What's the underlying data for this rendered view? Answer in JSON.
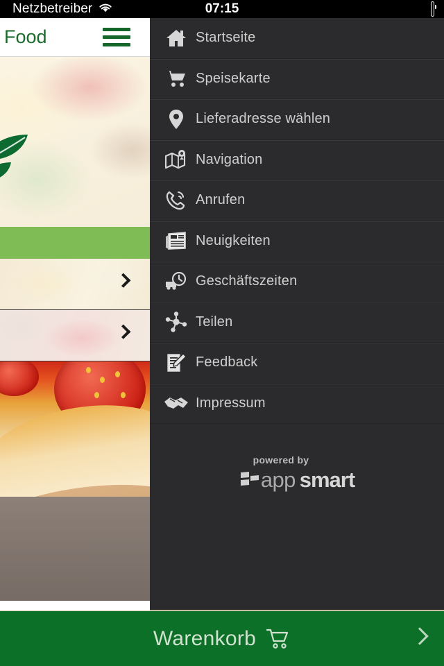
{
  "status_bar": {
    "carrier": "Netzbetreiber",
    "wifi_icon": "wifi-icon",
    "time": "07:15",
    "battery_icon": "battery-full-icon"
  },
  "app": {
    "title": "Food",
    "menu_button_icon": "hamburger-menu-icon",
    "hero_logo_icon": "leaf-logo-icon",
    "promo_band_color": "#7fbc56",
    "rows": [
      {
        "chevron_icon": "chevron-right-icon"
      },
      {
        "chevron_icon": "chevron-right-icon"
      }
    ]
  },
  "menu": {
    "background_color": "#2b2b2d",
    "items": [
      {
        "label": "Startseite",
        "icon": "home-icon"
      },
      {
        "label": "Speisekarte",
        "icon": "shopping-cart-icon"
      },
      {
        "label": "Lieferadresse wählen",
        "icon": "map-pin-icon"
      },
      {
        "label": "Navigation",
        "icon": "map-icon"
      },
      {
        "label": "Anrufen",
        "icon": "phone-call-icon"
      },
      {
        "label": "Neuigkeiten",
        "icon": "newspaper-icon"
      },
      {
        "label": "Geschäftszeiten",
        "icon": "delivery-clock-icon"
      },
      {
        "label": "Teilen",
        "icon": "share-network-icon"
      },
      {
        "label": "Feedback",
        "icon": "document-pen-icon"
      },
      {
        "label": "Impressum",
        "icon": "handshake-icon"
      }
    ],
    "powered_by": {
      "prefix": "powered by",
      "brand_first": "app",
      "brand_second": "smart",
      "mark_icon": "appsmart-logo-icon"
    }
  },
  "cart_bar": {
    "label": "Warenkorb",
    "cart_icon": "shopping-cart-icon",
    "chevron_icon": "chevron-right-icon",
    "background_color": "#0c7029"
  }
}
